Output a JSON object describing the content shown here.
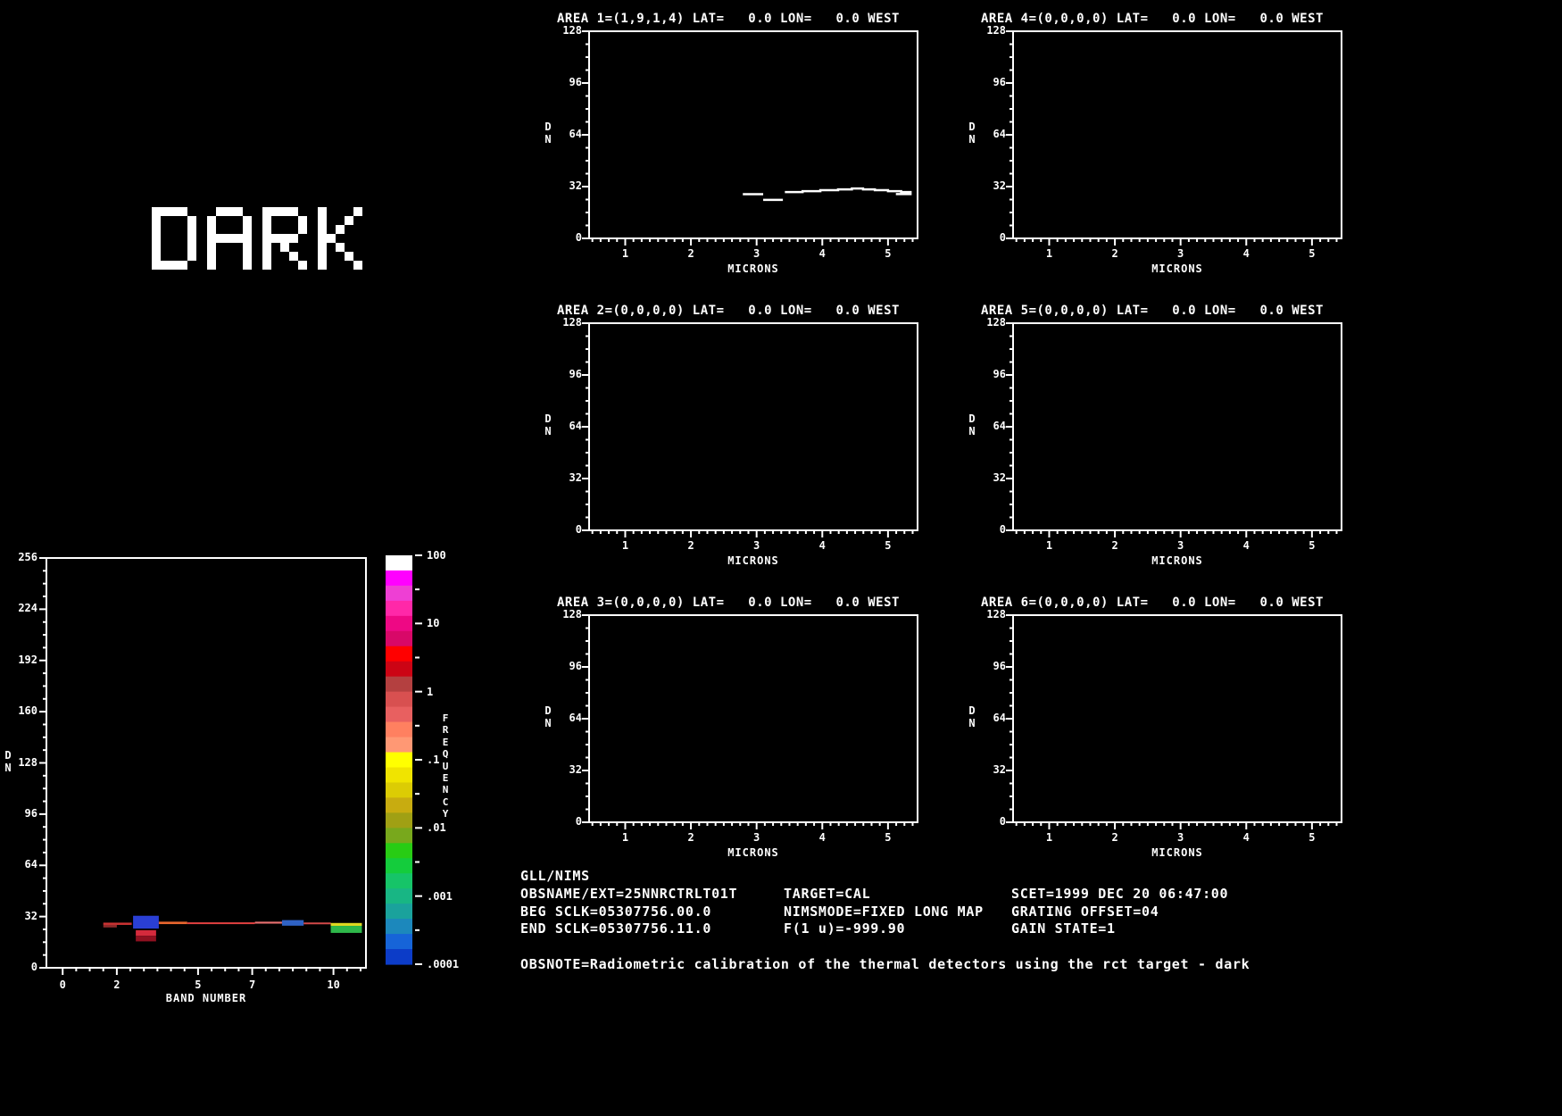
{
  "colors": {
    "background": "#000000",
    "foreground": "#ffffff"
  },
  "dark_label": {
    "text": "DARK"
  },
  "info": {
    "header": "GLL/NIMS",
    "col1": [
      "OBSNAME/EXT=25NNRCTRLT01T",
      "BEG SCLK=05307756.00.0",
      "END SCLK=05307756.11.0"
    ],
    "col2": [
      "TARGET=CAL",
      "NIMSMODE=FIXED LONG MAP",
      "F(1 u)=-999.90"
    ],
    "col3": [
      "SCET=1999 DEC 20 06:47:00",
      "GRATING OFFSET=04",
      "GAIN STATE=1"
    ],
    "obsnote": "OBSNOTE=Radiometric calibration of the thermal detectors using the rct target - dark"
  },
  "chart_data": [
    {
      "id": "area-1",
      "type": "line",
      "title": "AREA 1=(1,9,1,4) LAT=   0.0 LON=   0.0 WEST",
      "xlabel": "MICRONS",
      "ylabel": "DN",
      "xlim": [
        0.45,
        5.45
      ],
      "ylim": [
        0,
        128
      ],
      "xticks": [
        1,
        2,
        3,
        4,
        5
      ],
      "yticks": [
        0,
        32,
        64,
        96,
        128
      ],
      "segments": [
        [
          [
            2.79,
            27.3
          ],
          [
            3.1,
            27.3
          ]
        ],
        [
          [
            3.1,
            23.8
          ],
          [
            3.4,
            23.8
          ]
        ],
        [
          [
            3.43,
            28.6
          ],
          [
            3.7,
            28.6
          ],
          [
            3.7,
            29.2
          ],
          [
            3.97,
            29.2
          ],
          [
            3.97,
            29.8
          ],
          [
            4.24,
            29.8
          ],
          [
            4.24,
            30.3
          ],
          [
            4.45,
            30.3
          ],
          [
            4.45,
            30.8
          ],
          [
            4.62,
            30.8
          ],
          [
            4.62,
            30.3
          ],
          [
            4.8,
            30.3
          ],
          [
            4.8,
            29.8
          ],
          [
            5.0,
            29.8
          ],
          [
            5.0,
            29.2
          ],
          [
            5.2,
            29.2
          ],
          [
            5.2,
            28.6
          ],
          [
            5.36,
            28.6
          ]
        ],
        [
          [
            5.12,
            27.4
          ],
          [
            5.36,
            27.4
          ]
        ]
      ]
    },
    {
      "id": "area-2",
      "type": "line",
      "title": "AREA 2=(0,0,0,0) LAT=   0.0 LON=   0.0 WEST",
      "xlabel": "MICRONS",
      "ylabel": "DN",
      "xlim": [
        0.45,
        5.45
      ],
      "ylim": [
        0,
        128
      ],
      "xticks": [
        1,
        2,
        3,
        4,
        5
      ],
      "yticks": [
        0,
        32,
        64,
        96,
        128
      ],
      "segments": []
    },
    {
      "id": "area-3",
      "type": "line",
      "title": "AREA 3=(0,0,0,0) LAT=   0.0 LON=   0.0 WEST",
      "xlabel": "MICRONS",
      "ylabel": "DN",
      "xlim": [
        0.45,
        5.45
      ],
      "ylim": [
        0,
        128
      ],
      "xticks": [
        1,
        2,
        3,
        4,
        5
      ],
      "yticks": [
        0,
        32,
        64,
        96,
        128
      ],
      "segments": []
    },
    {
      "id": "area-4",
      "type": "line",
      "title": "AREA 4=(0,0,0,0) LAT=   0.0 LON=   0.0 WEST",
      "xlabel": "MICRONS",
      "ylabel": "DN",
      "xlim": [
        0.45,
        5.45
      ],
      "ylim": [
        0,
        128
      ],
      "xticks": [
        1,
        2,
        3,
        4,
        5
      ],
      "yticks": [
        0,
        32,
        64,
        96,
        128
      ],
      "segments": []
    },
    {
      "id": "area-5",
      "type": "line",
      "title": "AREA 5=(0,0,0,0) LAT=   0.0 LON=   0.0 WEST",
      "xlabel": "MICRONS",
      "ylabel": "DN",
      "xlim": [
        0.45,
        5.45
      ],
      "ylim": [
        0,
        128
      ],
      "xticks": [
        1,
        2,
        3,
        4,
        5
      ],
      "yticks": [
        0,
        32,
        64,
        96,
        128
      ],
      "segments": []
    },
    {
      "id": "area-6",
      "type": "line",
      "title": "AREA 6=(0,0,0,0) LAT=   0.0 LON=   0.0 WEST",
      "xlabel": "MICRONS",
      "ylabel": "DN",
      "xlim": [
        0.45,
        5.45
      ],
      "ylim": [
        0,
        128
      ],
      "xticks": [
        1,
        2,
        3,
        4,
        5
      ],
      "yticks": [
        0,
        32,
        64,
        96,
        128
      ],
      "segments": []
    },
    {
      "id": "histogram",
      "type": "heatmap",
      "title": "",
      "xlabel": "BAND NUMBER",
      "ylabel": "DN",
      "xlim": [
        -0.6,
        11.2
      ],
      "ylim": [
        0,
        256
      ],
      "xticks": [
        0,
        2,
        5,
        7,
        10
      ],
      "yticks": [
        0,
        32,
        64,
        96,
        128,
        160,
        192,
        224,
        256
      ],
      "cells": [
        {
          "x1": 1.5,
          "x2": 2.55,
          "y1": 26.8,
          "y2": 28.2,
          "color": "#cc3333"
        },
        {
          "x1": 1.5,
          "x2": 2.0,
          "y1": 25.2,
          "y2": 26.8,
          "color": "#8f2a2a"
        },
        {
          "x1": 2.6,
          "x2": 3.55,
          "y1": 24.5,
          "y2": 32.5,
          "color": "#2a3fd4"
        },
        {
          "x1": 2.7,
          "x2": 3.45,
          "y1": 20.0,
          "y2": 23.5,
          "color": "#d42a3c"
        },
        {
          "x1": 2.7,
          "x2": 3.45,
          "y1": 16.5,
          "y2": 20.0,
          "color": "#8f1020"
        },
        {
          "x1": 3.55,
          "x2": 4.6,
          "y1": 27.3,
          "y2": 28.8,
          "color": "#e8662e"
        },
        {
          "x1": 4.6,
          "x2": 7.1,
          "y1": 27.3,
          "y2": 28.4,
          "color": "#e04040"
        },
        {
          "x1": 7.1,
          "x2": 8.1,
          "y1": 27.6,
          "y2": 28.8,
          "color": "#e87070"
        },
        {
          "x1": 8.1,
          "x2": 8.9,
          "y1": 26.3,
          "y2": 29.8,
          "color": "#2f62c4"
        },
        {
          "x1": 8.9,
          "x2": 9.9,
          "y1": 27.2,
          "y2": 28.3,
          "color": "#d44a4a"
        },
        {
          "x1": 9.9,
          "x2": 11.05,
          "y1": 26.2,
          "y2": 28.0,
          "color": "#ddd820"
        },
        {
          "x1": 9.9,
          "x2": 11.05,
          "y1": 21.8,
          "y2": 26.2,
          "color": "#2eb84a"
        }
      ]
    },
    {
      "id": "colorbar",
      "type": "colorbar",
      "label": "FREQUENCY",
      "scale": "log",
      "tick_labels": [
        "100",
        "10",
        "1",
        ".1",
        ".01",
        ".001",
        ".0001"
      ],
      "colors": [
        "#ffffff",
        "#ff00ff",
        "#ee3fd4",
        "#ff28a8",
        "#ee0884",
        "#d80868",
        "#ff0000",
        "#cc0414",
        "#b44040",
        "#d85050",
        "#e86060",
        "#ff8060",
        "#ff9874",
        "#ffff00",
        "#f0e400",
        "#dccc04",
        "#c8ac10",
        "#a0a014",
        "#78a81c",
        "#28cc14",
        "#14cc3c",
        "#16c468",
        "#18b684",
        "#1aa29c",
        "#1c88bc",
        "#1664d8",
        "#0c3cc8"
      ]
    }
  ]
}
